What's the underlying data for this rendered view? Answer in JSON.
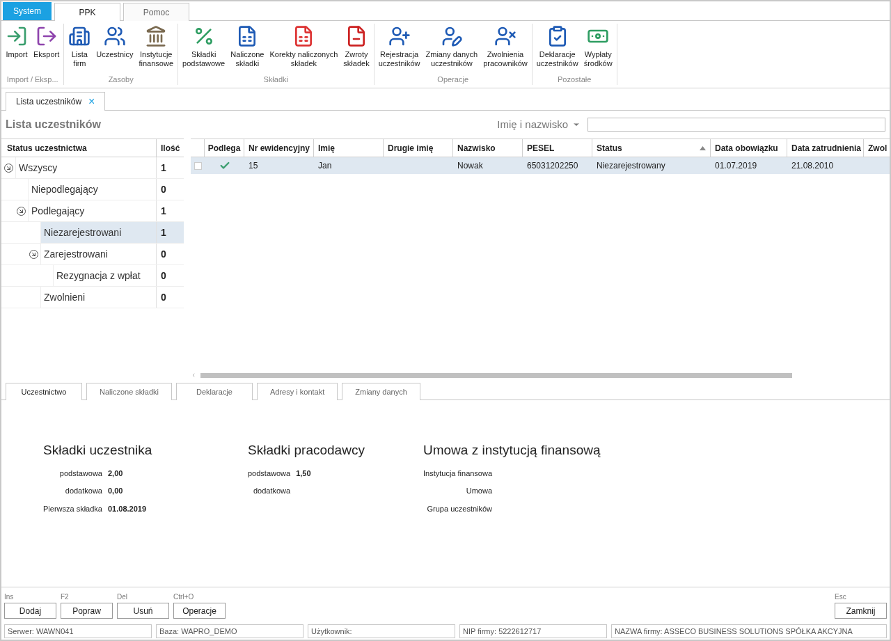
{
  "menu_tabs": [
    {
      "label": "System",
      "kind": "app",
      "selected": false
    },
    {
      "label": "PPK",
      "kind": "tab",
      "selected": true
    },
    {
      "label": "Pomoc",
      "kind": "tab",
      "selected": false
    }
  ],
  "ribbon_groups": [
    {
      "label": "Import / Eksp...",
      "items": [
        "Import",
        "Eksport"
      ]
    },
    {
      "label": "Zasoby",
      "items": [
        "Lista\nfirm",
        "Uczestnicy",
        "Instytucje\nfinansowe"
      ]
    },
    {
      "label": "Składki",
      "items": [
        "Składki\npodstawowe",
        "Naliczone\nskładki",
        "Korekty naliczonych\nskładek",
        "Zwroty\nskładek"
      ]
    },
    {
      "label": "Operacje",
      "items": [
        "Rejestracja\nuczestników",
        "Zmiany danych\nuczestników",
        "Zwolnienia\npracowników"
      ]
    },
    {
      "label": "Pozostałe",
      "items": [
        "Deklaracje\nuczestników",
        "Wypłaty\nśrodków"
      ]
    }
  ],
  "document_tab": {
    "label": "Lista uczestników",
    "close": "×"
  },
  "page_title": "Lista uczestników",
  "search": {
    "filter": "Imię i nazwisko"
  },
  "status_tree": {
    "columns": [
      "Status uczestnictwa",
      "Ilość"
    ],
    "items": [
      {
        "label": "Wszyscy",
        "count": "1",
        "expanded": true,
        "selected": false,
        "children": [
          {
            "label": "Niepodlegający",
            "count": "0",
            "selected": false
          },
          {
            "label": "Podlegający",
            "count": "1",
            "expanded": true,
            "selected": false,
            "children": [
              {
                "label": "Niezarejestrowani",
                "count": "1",
                "selected": true
              },
              {
                "label": "Zarejestrowani",
                "count": "0",
                "expanded": true,
                "selected": false,
                "children": [
                  {
                    "label": "Rezygnacja z wpłat",
                    "count": "0",
                    "selected": false
                  }
                ]
              },
              {
                "label": "Zwolnieni",
                "count": "0",
                "selected": false
              }
            ]
          }
        ]
      }
    ]
  },
  "table": {
    "columns": [
      {
        "label": "Podlega"
      },
      {
        "label": "Nr ewidencyjny"
      },
      {
        "label": "Imię"
      },
      {
        "label": "Drugie imię"
      },
      {
        "label": "Nazwisko"
      },
      {
        "label": "PESEL"
      },
      {
        "label": "Status",
        "sorted": true
      },
      {
        "label": "Data obowiązku"
      },
      {
        "label": "Data zatrudnienia"
      },
      {
        "label": "Zwol"
      }
    ],
    "rows": [
      {
        "checked": false,
        "selected": true,
        "podlega": true,
        "cells": [
          "",
          "15",
          "Jan",
          "",
          "Nowak",
          "65031202250",
          "Niezarejestrowany",
          "01.07.2019",
          "21.08.2010",
          ""
        ]
      }
    ]
  },
  "detail_tabs": [
    {
      "label": "Uczestnictwo",
      "selected": true
    },
    {
      "label": "Naliczone składki",
      "selected": false
    },
    {
      "label": "Deklaracje",
      "selected": false
    },
    {
      "label": "Adresy i kontakt",
      "selected": false
    },
    {
      "label": "Zmiany danych",
      "selected": false
    }
  ],
  "detail_sections": [
    {
      "title": "Składki uczestnika",
      "fields": [
        {
          "label": "podstawowa",
          "value": "2,00"
        },
        {
          "label": "dodatkowa",
          "value": "0,00"
        },
        {
          "label": "Pierwsza składka",
          "value": "01.08.2019"
        }
      ]
    },
    {
      "title": "Składki pracodawcy",
      "fields": [
        {
          "label": "podstawowa",
          "value": "1,50"
        },
        {
          "label": "dodatkowa"
        }
      ]
    },
    {
      "title": "Umowa z instytucją finansową",
      "fields": [
        {
          "label": "Instytucja finansowa"
        },
        {
          "label": "Umowa"
        },
        {
          "label": "Grupa uczestników"
        }
      ]
    }
  ],
  "actions_left": [
    {
      "shortcut": "Ins",
      "label": "Dodaj"
    },
    {
      "shortcut": "F2",
      "label": "Popraw"
    },
    {
      "shortcut": "Del",
      "label": "Usuń"
    },
    {
      "shortcut": "Ctrl+O",
      "label": "Operacje"
    }
  ],
  "actions_right": [
    {
      "shortcut": "Esc",
      "label": "Zamknij"
    }
  ],
  "status_bar": [
    "Serwer: WAWN041",
    "Baza: WAPRO_DEMO",
    "Użytkownik:",
    "NIP firmy: 5222612717",
    "NAZWA firmy: ASSECO BUSINESS SOLUTIONS SPÓŁKA AKCYJNA"
  ]
}
